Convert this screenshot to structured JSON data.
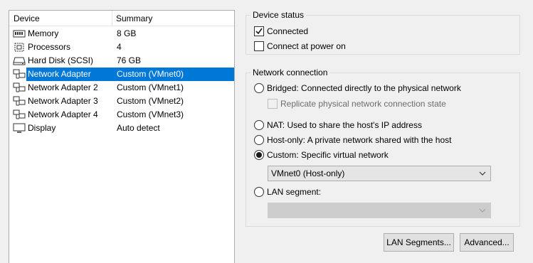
{
  "device_list": {
    "col_device": "Device",
    "col_summary": "Summary",
    "rows": [
      {
        "name": "Memory",
        "summary": "8 GB",
        "icon": "memory-icon"
      },
      {
        "name": "Processors",
        "summary": "4",
        "icon": "processor-icon"
      },
      {
        "name": "Hard Disk (SCSI)",
        "summary": "76 GB",
        "icon": "hard-disk-icon"
      },
      {
        "name": "Network Adapter",
        "summary": "Custom (VMnet0)",
        "icon": "network-adapter-icon",
        "selected": true
      },
      {
        "name": "Network Adapter 2",
        "summary": "Custom (VMnet1)",
        "icon": "network-adapter-icon"
      },
      {
        "name": "Network Adapter 3",
        "summary": "Custom (VMnet2)",
        "icon": "network-adapter-icon"
      },
      {
        "name": "Network Adapter 4",
        "summary": "Custom (VMnet3)",
        "icon": "network-adapter-icon"
      },
      {
        "name": "Display",
        "summary": "Auto detect",
        "icon": "display-icon"
      }
    ]
  },
  "device_status": {
    "title": "Device status",
    "connected_label": "Connected",
    "connected_checked": true,
    "power_on_label": "Connect at power on",
    "power_on_checked": false
  },
  "network_connection": {
    "title": "Network connection",
    "bridged_label": "Bridged: Connected directly to the physical network",
    "replicate_label": "Replicate physical network connection state",
    "nat_label": "NAT: Used to share the host's IP address",
    "hostonly_label": "Host-only: A private network shared with the host",
    "custom_label": "Custom: Specific virtual network",
    "custom_value": "VMnet0 (Host-only)",
    "lan_label": "LAN segment:",
    "lan_value": "",
    "selected": "custom"
  },
  "buttons": {
    "lan_segments": "LAN Segments...",
    "advanced": "Advanced..."
  },
  "colors": {
    "selection": "#0078d7"
  }
}
